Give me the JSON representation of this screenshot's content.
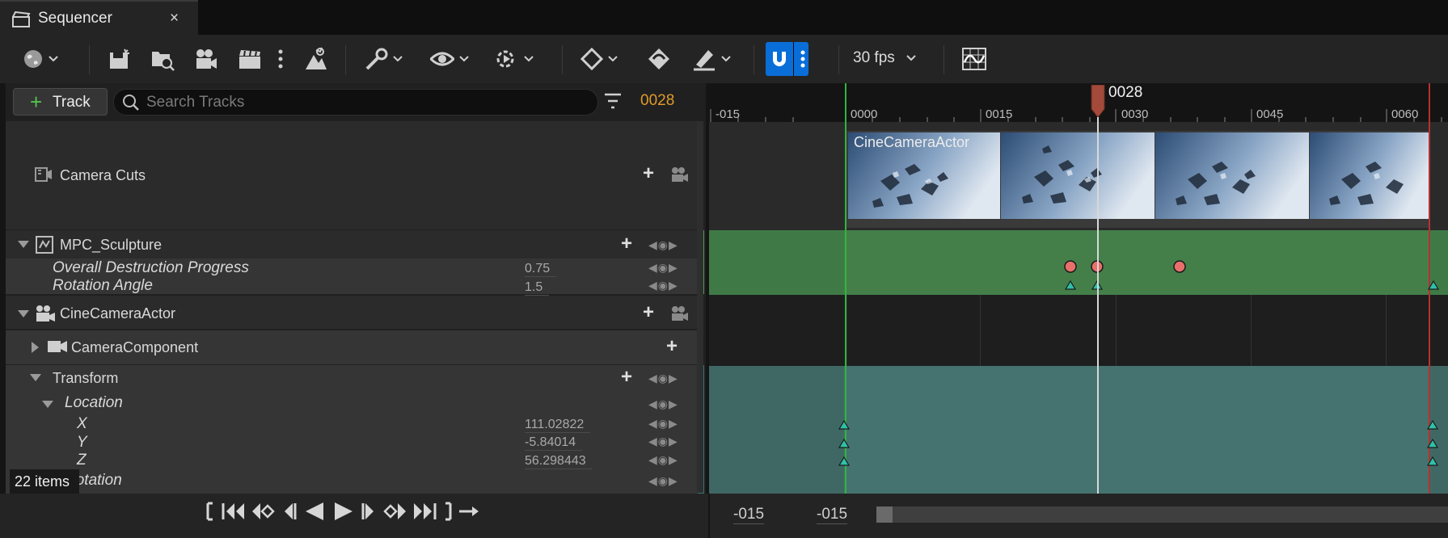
{
  "tab": {
    "title": "Sequencer",
    "close": "×"
  },
  "toolbar": {
    "fps": "30 fps",
    "icons": [
      "world-icon",
      "save-icon",
      "find-asset-icon",
      "camera-actor-icon",
      "clapper-icon",
      "more-icon",
      "render-icon",
      "tools-icon",
      "view-icon",
      "playback-icon",
      "key-icon",
      "key-interp-icon",
      "edit-icon",
      "snap-magnet-icon",
      "curve-editor-icon"
    ],
    "snap_active_color": "#0a6ed8"
  },
  "tracks_panel": {
    "add_track_label": "Track",
    "search_placeholder": "Search Tracks",
    "current_frame": "0028",
    "items_count": "22 items",
    "rows": [
      {
        "name": "Camera Cuts"
      },
      {
        "name": "MPC_Sculpture"
      },
      {
        "name": "Overall Destruction Progress",
        "value": "0.75"
      },
      {
        "name": "Rotation Angle",
        "value": "1.5"
      },
      {
        "name": "CineCameraActor"
      },
      {
        "name": "CameraComponent"
      },
      {
        "name": "Transform"
      },
      {
        "name": "Location"
      },
      {
        "name": "X",
        "value": "111.02822"
      },
      {
        "name": "Y",
        "value": "-5.84014"
      },
      {
        "name": "Z",
        "value": "56.298443"
      },
      {
        "name": "Rotation"
      }
    ]
  },
  "timeline": {
    "ticks": [
      "-015",
      "0000",
      "0015",
      "0030",
      "0045",
      "0060"
    ],
    "playhead_frame": "0028",
    "camera_cut_label": "CineCameraActor",
    "range_start": "-015",
    "range_end": "-015"
  },
  "colors": {
    "mpc_lane": "#447f49",
    "transform_lane": "#457370",
    "playhead": "#a34a3a",
    "key_red": "#e8706a",
    "key_teal": "#2fc0a8"
  }
}
